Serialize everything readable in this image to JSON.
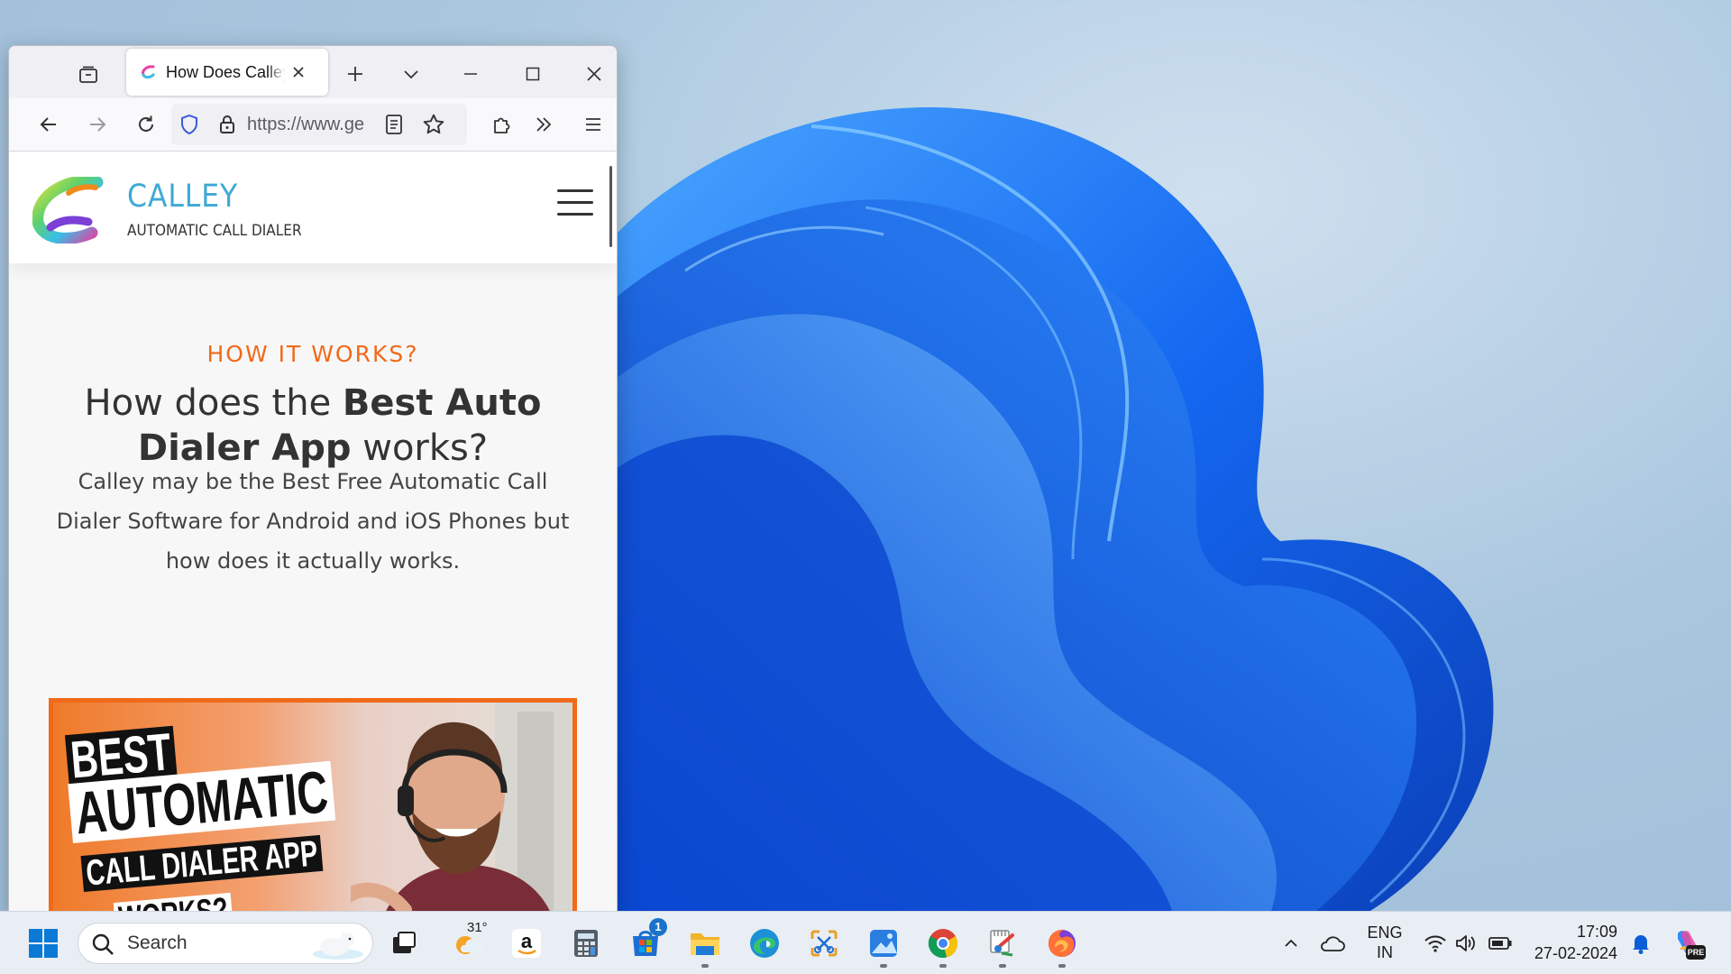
{
  "colors": {
    "accent_orange": "#f06a19",
    "brand_blue": "#3ea9d6",
    "wallpaper_blue": "#1565e6"
  },
  "browser": {
    "tab_title": "How Does Calley Work? | Auto Dialer App",
    "url": "https://www.ge",
    "icons": {
      "tab_list": "tab-list-icon",
      "new_tab": "plus-icon",
      "list_all_tabs": "chevron-down-icon",
      "minimize": "minimize-icon",
      "maximize": "maximize-icon",
      "close": "close-icon",
      "back": "arrow-left-icon",
      "forward": "arrow-right-icon",
      "reload": "reload-icon",
      "tracking_protection": "shield-icon",
      "site_security": "lock-icon",
      "reader_view": "reader-view-icon",
      "bookmark": "star-icon",
      "extensions": "puzzle-icon",
      "overflow": "double-chevron-icon",
      "app_menu": "hamburger-menu-icon"
    }
  },
  "page": {
    "brand_name": "CALLEY",
    "brand_tagline": "AUTOMATIC CALL DIALER",
    "eyebrow": "HOW IT WORKS?",
    "headline_prefix": "How does the",
    "headline_bold": "Best Auto Dialer App",
    "headline_suffix": "works?",
    "lead": "Calley may be the Best Free Automatic Call Dialer Software for Android and iOS Phones but how does it actually works.",
    "thumbnail": {
      "line1": "BEST",
      "line2": "AUTOMATIC",
      "line3": "CALL DIALER APP",
      "line4": "WORKS?"
    }
  },
  "taskbar": {
    "search_placeholder": "Search",
    "weather_temp": "31°",
    "store_badge": "1",
    "language_line1": "ENG",
    "language_line2": "IN",
    "time": "17:09",
    "date": "27-02-2024",
    "copilot_badge": "PRE",
    "apps": [
      "start-icon",
      "task-view-icon",
      "weather-icon",
      "amazon-icon",
      "calculator-icon",
      "microsoft-store-icon",
      "file-explorer-icon",
      "edge-icon",
      "snipping-icon",
      "photos-icon",
      "chrome-icon",
      "paint-icon",
      "firefox-icon"
    ]
  }
}
